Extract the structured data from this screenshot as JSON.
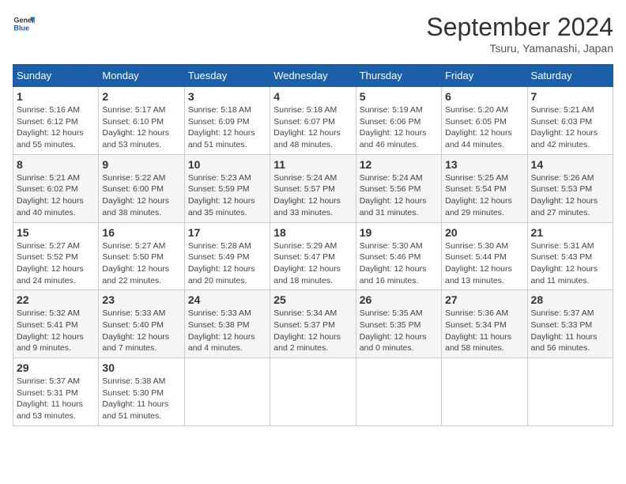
{
  "header": {
    "logo": {
      "general": "General",
      "blue": "Blue"
    },
    "month_title": "September 2024",
    "location": "Tsuru, Yamanashi, Japan"
  },
  "calendar": {
    "days_of_week": [
      "Sunday",
      "Monday",
      "Tuesday",
      "Wednesday",
      "Thursday",
      "Friday",
      "Saturday"
    ],
    "weeks": [
      [
        {
          "day": "",
          "info": ""
        },
        {
          "day": "2",
          "info": "Sunrise: 5:17 AM\nSunset: 6:10 PM\nDaylight: 12 hours\nand 53 minutes."
        },
        {
          "day": "3",
          "info": "Sunrise: 5:18 AM\nSunset: 6:09 PM\nDaylight: 12 hours\nand 51 minutes."
        },
        {
          "day": "4",
          "info": "Sunrise: 5:18 AM\nSunset: 6:07 PM\nDaylight: 12 hours\nand 48 minutes."
        },
        {
          "day": "5",
          "info": "Sunrise: 5:19 AM\nSunset: 6:06 PM\nDaylight: 12 hours\nand 46 minutes."
        },
        {
          "day": "6",
          "info": "Sunrise: 5:20 AM\nSunset: 6:05 PM\nDaylight: 12 hours\nand 44 minutes."
        },
        {
          "day": "7",
          "info": "Sunrise: 5:21 AM\nSunset: 6:03 PM\nDaylight: 12 hours\nand 42 minutes."
        }
      ],
      [
        {
          "day": "8",
          "info": "Sunrise: 5:21 AM\nSunset: 6:02 PM\nDaylight: 12 hours\nand 40 minutes."
        },
        {
          "day": "9",
          "info": "Sunrise: 5:22 AM\nSunset: 6:00 PM\nDaylight: 12 hours\nand 38 minutes."
        },
        {
          "day": "10",
          "info": "Sunrise: 5:23 AM\nSunset: 5:59 PM\nDaylight: 12 hours\nand 35 minutes."
        },
        {
          "day": "11",
          "info": "Sunrise: 5:24 AM\nSunset: 5:57 PM\nDaylight: 12 hours\nand 33 minutes."
        },
        {
          "day": "12",
          "info": "Sunrise: 5:24 AM\nSunset: 5:56 PM\nDaylight: 12 hours\nand 31 minutes."
        },
        {
          "day": "13",
          "info": "Sunrise: 5:25 AM\nSunset: 5:54 PM\nDaylight: 12 hours\nand 29 minutes."
        },
        {
          "day": "14",
          "info": "Sunrise: 5:26 AM\nSunset: 5:53 PM\nDaylight: 12 hours\nand 27 minutes."
        }
      ],
      [
        {
          "day": "15",
          "info": "Sunrise: 5:27 AM\nSunset: 5:52 PM\nDaylight: 12 hours\nand 24 minutes."
        },
        {
          "day": "16",
          "info": "Sunrise: 5:27 AM\nSunset: 5:50 PM\nDaylight: 12 hours\nand 22 minutes."
        },
        {
          "day": "17",
          "info": "Sunrise: 5:28 AM\nSunset: 5:49 PM\nDaylight: 12 hours\nand 20 minutes."
        },
        {
          "day": "18",
          "info": "Sunrise: 5:29 AM\nSunset: 5:47 PM\nDaylight: 12 hours\nand 18 minutes."
        },
        {
          "day": "19",
          "info": "Sunrise: 5:30 AM\nSunset: 5:46 PM\nDaylight: 12 hours\nand 16 minutes."
        },
        {
          "day": "20",
          "info": "Sunrise: 5:30 AM\nSunset: 5:44 PM\nDaylight: 12 hours\nand 13 minutes."
        },
        {
          "day": "21",
          "info": "Sunrise: 5:31 AM\nSunset: 5:43 PM\nDaylight: 12 hours\nand 11 minutes."
        }
      ],
      [
        {
          "day": "22",
          "info": "Sunrise: 5:32 AM\nSunset: 5:41 PM\nDaylight: 12 hours\nand 9 minutes."
        },
        {
          "day": "23",
          "info": "Sunrise: 5:33 AM\nSunset: 5:40 PM\nDaylight: 12 hours\nand 7 minutes."
        },
        {
          "day": "24",
          "info": "Sunrise: 5:33 AM\nSunset: 5:38 PM\nDaylight: 12 hours\nand 4 minutes."
        },
        {
          "day": "25",
          "info": "Sunrise: 5:34 AM\nSunset: 5:37 PM\nDaylight: 12 hours\nand 2 minutes."
        },
        {
          "day": "26",
          "info": "Sunrise: 5:35 AM\nSunset: 5:35 PM\nDaylight: 12 hours\nand 0 minutes."
        },
        {
          "day": "27",
          "info": "Sunrise: 5:36 AM\nSunset: 5:34 PM\nDaylight: 11 hours\nand 58 minutes."
        },
        {
          "day": "28",
          "info": "Sunrise: 5:37 AM\nSunset: 5:33 PM\nDaylight: 11 hours\nand 56 minutes."
        }
      ],
      [
        {
          "day": "29",
          "info": "Sunrise: 5:37 AM\nSunset: 5:31 PM\nDaylight: 11 hours\nand 53 minutes."
        },
        {
          "day": "30",
          "info": "Sunrise: 5:38 AM\nSunset: 5:30 PM\nDaylight: 11 hours\nand 51 minutes."
        },
        {
          "day": "",
          "info": ""
        },
        {
          "day": "",
          "info": ""
        },
        {
          "day": "",
          "info": ""
        },
        {
          "day": "",
          "info": ""
        },
        {
          "day": "",
          "info": ""
        }
      ]
    ],
    "first_day_number": "1",
    "first_day_info": "Sunrise: 5:16 AM\nSunset: 6:12 PM\nDaylight: 12 hours\nand 55 minutes."
  }
}
